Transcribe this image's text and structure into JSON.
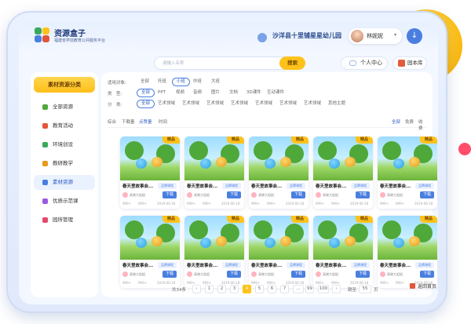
{
  "brand": {
    "title": "资源盒子",
    "subtitle": "福建省学前教育公共服务平台"
  },
  "header": {
    "school": "沙洋县十里铺星星幼儿园",
    "user": "林妮妮",
    "user_caret": "▾",
    "download_icon": "download-icon"
  },
  "search": {
    "placeholder": "请输入名称",
    "button": "搜索"
  },
  "top_buttons": {
    "personal_center": "个人中心",
    "library": "园本库"
  },
  "colors": {
    "accent": "#4a7fe0",
    "highlight": "#ffc21a",
    "brand_dark": "#1f3c7a"
  },
  "sidebar": {
    "heading": "素材资源分类",
    "items": [
      {
        "label": "全部资源",
        "active": false,
        "color": "#4fa83a"
      },
      {
        "label": "教育活动",
        "active": false,
        "color": "#e2553b"
      },
      {
        "label": "环境创设",
        "active": false,
        "color": "#3aa85c"
      },
      {
        "label": "教研教学",
        "active": false,
        "color": "#e69a1a"
      },
      {
        "label": "素材资源",
        "active": true,
        "color": "#4a7fe0"
      },
      {
        "label": "优质示范课",
        "active": false,
        "color": "#9b59e0"
      },
      {
        "label": "园所管理",
        "active": false,
        "color": "#e24a6a"
      }
    ]
  },
  "filters": {
    "rows": [
      {
        "label": "适用对象:",
        "chips": [
          "全部",
          "托班",
          "小班",
          "中班",
          "大班"
        ],
        "active": 2
      },
      {
        "label": "类　型:",
        "chips": [
          "全部",
          "PPT",
          "视频",
          "音频",
          "图片",
          "文档",
          "3D课件",
          "互动课件"
        ],
        "active": 0
      },
      {
        "label": "分　类:",
        "chips": [
          "全部",
          "艺术领域",
          "艺术领域",
          "艺术领域",
          "艺术领域",
          "艺术领域",
          "艺术领域",
          "艺术领域",
          "其他主题"
        ],
        "active": 0
      }
    ],
    "sort": {
      "items": [
        "综合",
        "下载量",
        "点赞量",
        "时间"
      ],
      "active": 2,
      "right": [
        "全部",
        "免费",
        "收费"
      ],
      "right_active": 0
    }
  },
  "cards": {
    "title": "春天里故事会...",
    "tag": "品牌课程",
    "badge": "精品",
    "author": "高晓大姐姐",
    "download": "下载",
    "views": "999+",
    "likes": "999+",
    "date": "2019-06-18",
    "count": 10
  },
  "pager": {
    "total": "共34条",
    "prev": "‹",
    "pages": [
      "1",
      "2",
      "3",
      "4",
      "5",
      "6",
      "7",
      "...",
      "99",
      "100"
    ],
    "active": 3,
    "next": "›",
    "goto_label": "跳至",
    "goto_value": "55",
    "page_unit": "页"
  },
  "back": "返回首页"
}
